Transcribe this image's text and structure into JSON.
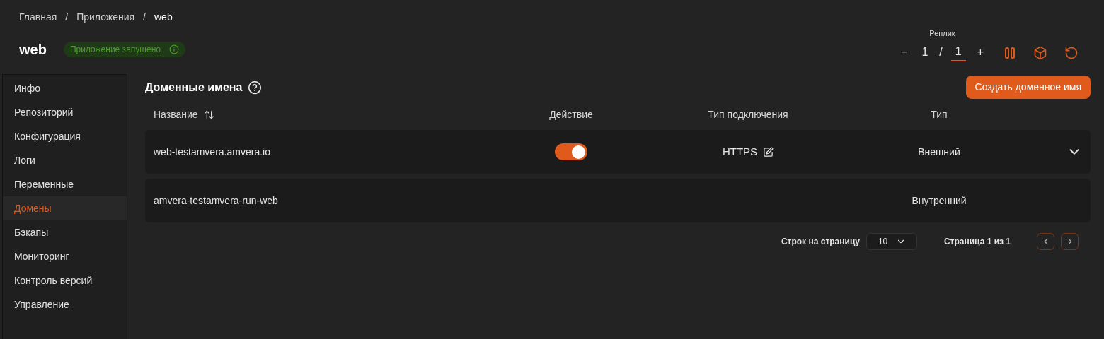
{
  "breadcrumbs": [
    "Главная",
    "Приложения",
    "web"
  ],
  "breadcrumb_separator": "/",
  "app": {
    "title": "web",
    "status": "Приложение запущено",
    "running": true
  },
  "replicas": {
    "label": "Реплик",
    "minus": "−",
    "current": "1",
    "separator": "/",
    "target": "1",
    "plus": "+"
  },
  "sidebar": {
    "items": [
      {
        "label": "Инфо",
        "selected": false
      },
      {
        "label": "Репозиторий",
        "selected": false
      },
      {
        "label": "Конфигурация",
        "selected": false
      },
      {
        "label": "Логи",
        "selected": false
      },
      {
        "label": "Переменные",
        "selected": false
      },
      {
        "label": "Домены",
        "selected": true
      },
      {
        "label": "Бэкапы",
        "selected": false
      },
      {
        "label": "Мониторинг",
        "selected": false
      },
      {
        "label": "Контроль версий",
        "selected": false
      },
      {
        "label": "Управление",
        "selected": false
      }
    ]
  },
  "section": {
    "title": "Доменные имена",
    "create_button": "Создать доменное имя"
  },
  "table": {
    "columns": [
      "Название",
      "Действие",
      "Тип подключения",
      "Тип"
    ],
    "rows": [
      {
        "name": "web-testamvera.amvera.io",
        "enabled": true,
        "connection": "HTTPS",
        "type": "Внешний",
        "expandable": true
      },
      {
        "name": "amvera-testamvera-run-web",
        "type": "Внутренний",
        "expandable": false
      }
    ]
  },
  "pagination": {
    "rows_label": "Строк на страницу",
    "page_size": "10",
    "page_info": "Страница 1 из 1"
  }
}
